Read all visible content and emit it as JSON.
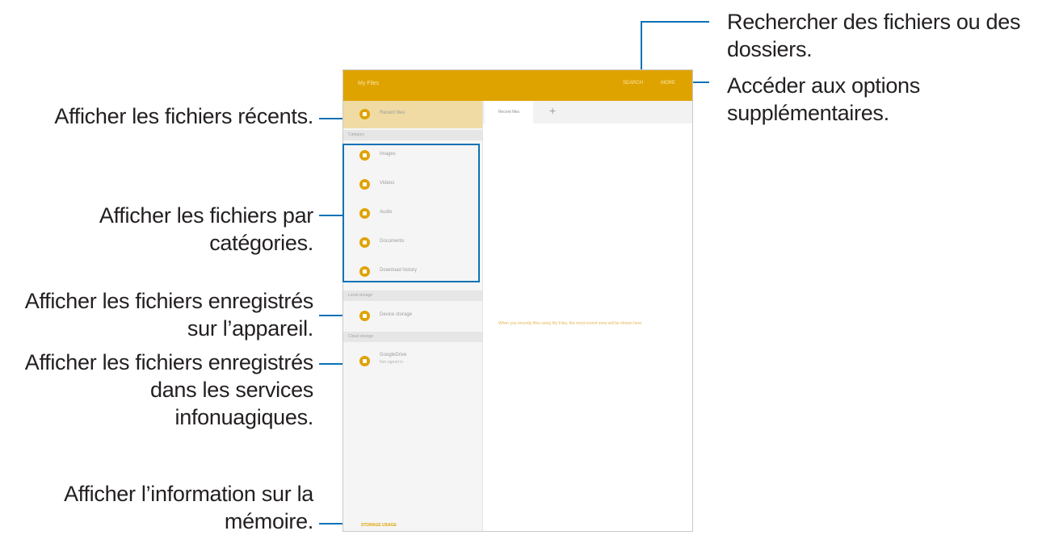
{
  "annotations": {
    "search": [
      "Rechercher des fichiers ou des",
      "dossiers."
    ],
    "options": [
      "Accéder aux options",
      "supplémentaires."
    ],
    "recent": [
      "Afficher les fichiers récents."
    ],
    "categories": [
      "Afficher les fichiers par",
      "catégories."
    ],
    "device": [
      "Afficher les fichiers enregistrés",
      "sur l’appareil."
    ],
    "cloud": [
      "Afficher les fichiers enregistrés",
      "dans les services",
      "infonuagiques."
    ],
    "memory": [
      "Afficher l’information sur la",
      "mémoire."
    ]
  },
  "app": {
    "title": "My Files",
    "search_label": "SEARCH",
    "more_label": "MORE"
  },
  "sidebar": {
    "recent": "Recent files",
    "category_header": "Category",
    "categories": [
      "Images",
      "Videos",
      "Audio",
      "Documents",
      "Download history"
    ],
    "local_header": "Local storage",
    "device_storage": "Device storage",
    "cloud_header": "Cloud storage",
    "cloud_name": "GoogleDrive",
    "cloud_sub": "Not signed in",
    "storage_usage": "STORAGE USAGE"
  },
  "tabs": {
    "active": "Recent files",
    "add": "+"
  },
  "main": {
    "empty_message": "When you recently files using My Files, the most recent ones will be shown here."
  },
  "colors": {
    "accent": "#dfa300",
    "annotation_line": "#0b72b5"
  }
}
